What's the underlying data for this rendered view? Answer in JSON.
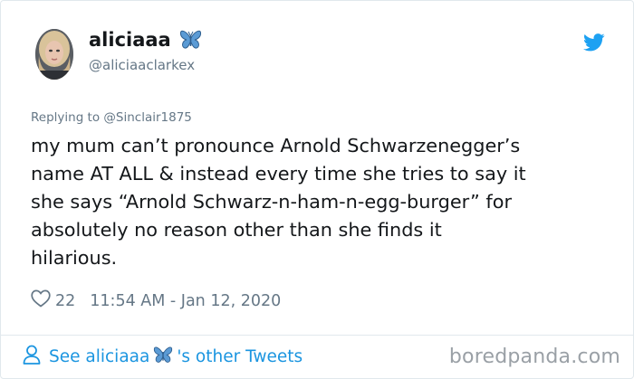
{
  "user": {
    "display_name": "aliciaaa",
    "handle": "@aliciaaclarkex",
    "name_emoji": "butterfly-emoji"
  },
  "tweet": {
    "reply_context": "Replying to @Sinclair1875",
    "text": "my mum can’t pronounce Arnold Schwarzenegger’s\nname AT ALL & instead every time she tries to say it\nshe says “Arnold Schwarz-n-ham-n-egg-burger” for\nabsolutely no reason other than she finds it\nhilarious.",
    "likes": "22",
    "timestamp": "11:54 AM - Jan 12, 2020"
  },
  "footer": {
    "see_prefix": "See aliciaaa",
    "see_suffix": "'s other Tweets"
  },
  "watermark": "boredpanda.com",
  "colors": {
    "twitter_blue": "#1da1f2",
    "link_blue": "#1b95e0",
    "secondary_text": "#657786",
    "butterfly": "#5b9bd5"
  },
  "icons": [
    "avatar",
    "butterfly-icon",
    "twitter-bird-icon",
    "heart-icon",
    "person-icon"
  ]
}
